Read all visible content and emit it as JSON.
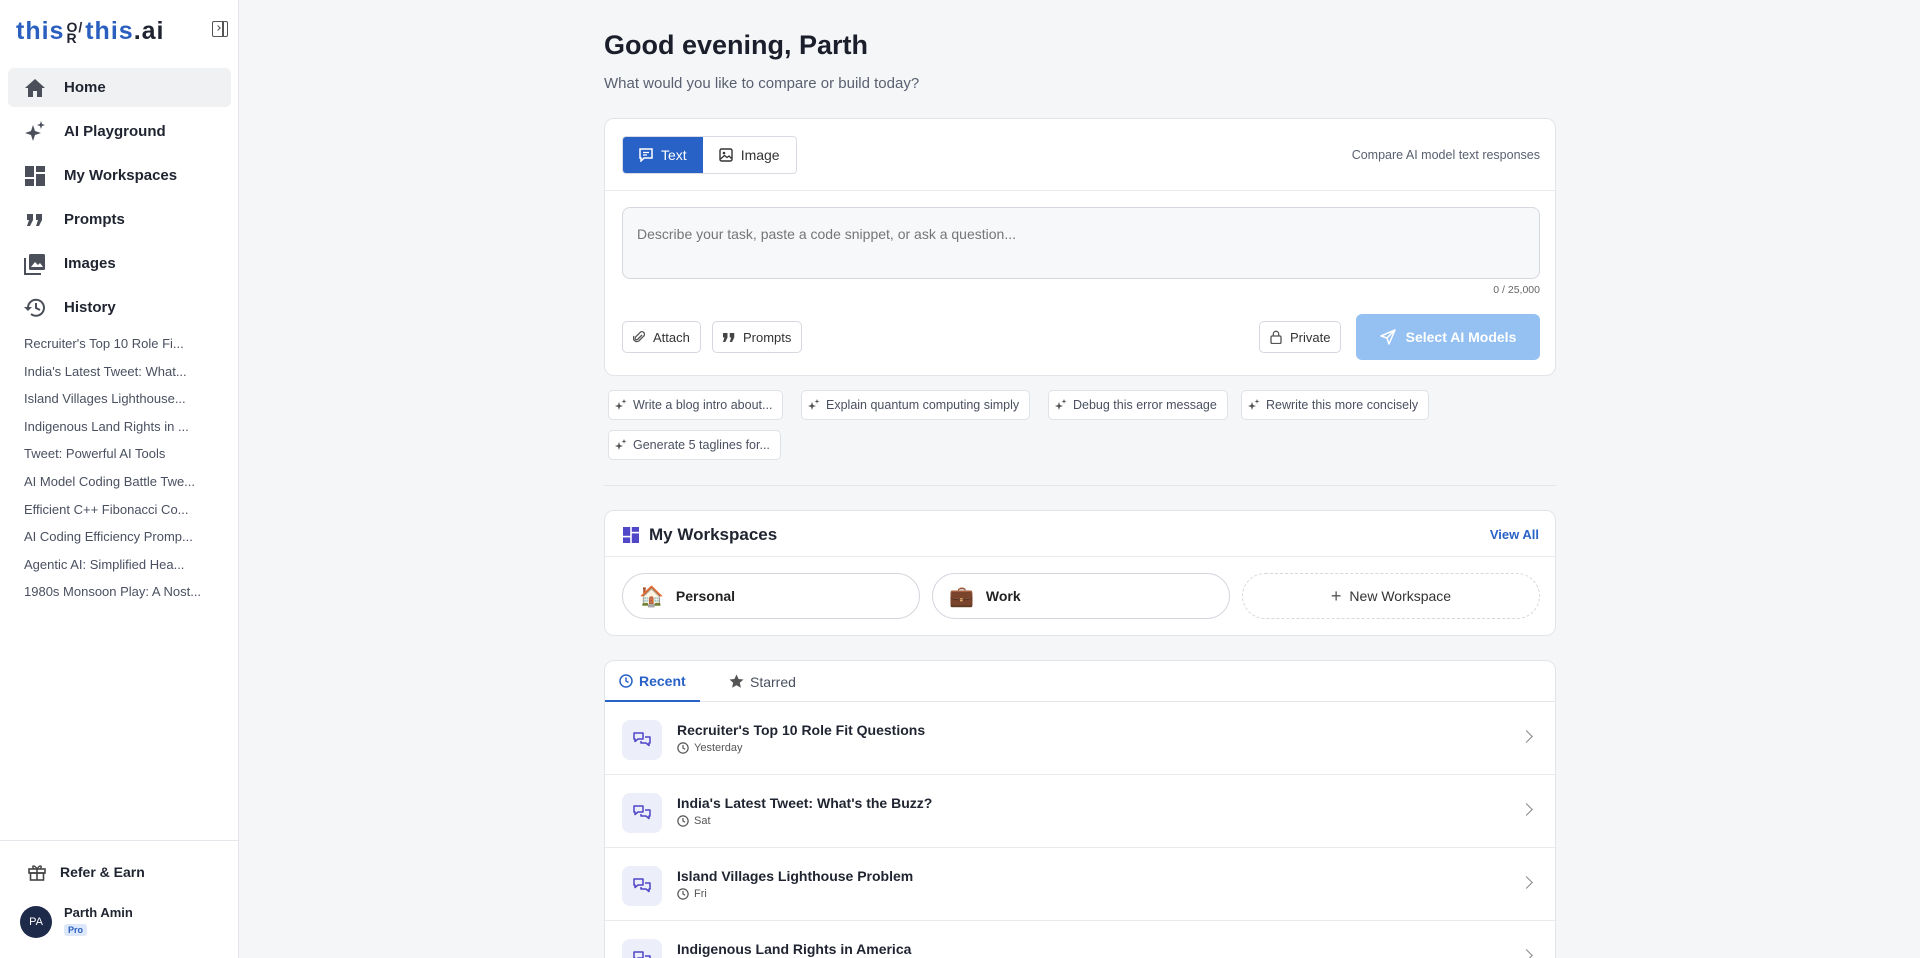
{
  "brand": {
    "part1": "this",
    "or_top": "O/",
    "or_bottom": "R",
    "part2": "this",
    "suffix": ".ai"
  },
  "nav": [
    {
      "label": "Home",
      "icon": "home-icon"
    },
    {
      "label": "AI Playground",
      "icon": "sparkles-icon"
    },
    {
      "label": "My Workspaces",
      "icon": "dashboard-icon"
    },
    {
      "label": "Prompts",
      "icon": "quote-icon"
    },
    {
      "label": "Images",
      "icon": "images-icon"
    },
    {
      "label": "History",
      "icon": "history-icon"
    }
  ],
  "history": [
    "Recruiter's Top 10 Role Fi...",
    "India's Latest Tweet: What...",
    "Island Villages Lighthouse...",
    "Indigenous Land Rights in ...",
    "Tweet: Powerful AI Tools",
    "AI Model Coding Battle Twe...",
    "Efficient C++ Fibonacci Co...",
    "AI Coding Efficiency Promp...",
    "Agentic AI: Simplified Hea...",
    "1980s Monsoon Play: A Nost..."
  ],
  "sidebar_bottom": {
    "refer_label": "Refer & Earn",
    "user_initials": "PA",
    "user_name": "Parth Amin",
    "plan": "Pro"
  },
  "main": {
    "greeting": "Good evening, Parth",
    "subtitle": "What would you like to compare or build today?",
    "compose": {
      "mode_text": "Text",
      "mode_image": "Image",
      "hint": "Compare AI model text responses",
      "placeholder": "Describe your task, paste a code snippet, or ask a question...",
      "counter": "0 / 25,000",
      "attach": "Attach",
      "prompts": "Prompts",
      "private": "Private",
      "select_models": "Select AI Models"
    },
    "suggestions": [
      "Write a blog intro about...",
      "Explain quantum computing simply",
      "Debug this error message",
      "Rewrite this more concisely",
      "Generate 5 taglines for..."
    ],
    "workspaces": {
      "title": "My Workspaces",
      "view_all": "View All",
      "items": [
        {
          "emoji": "🏠",
          "name": "Personal"
        },
        {
          "emoji": "💼",
          "name": "Work"
        }
      ],
      "new_label": "New Workspace"
    },
    "recent": {
      "tabs": [
        "Recent",
        "Starred"
      ],
      "items": [
        {
          "title": "Recruiter's Top 10 Role Fit Questions",
          "time": "Yesterday"
        },
        {
          "title": "India's Latest Tweet: What's the Buzz?",
          "time": "Sat"
        },
        {
          "title": "Island Villages Lighthouse Problem",
          "time": "Fri"
        },
        {
          "title": "Indigenous Land Rights in America",
          "time": ""
        }
      ]
    }
  },
  "colors": {
    "accent": "#2962c6",
    "brand": "#2a5fbf",
    "disabled_cta": "#95c0f2"
  }
}
